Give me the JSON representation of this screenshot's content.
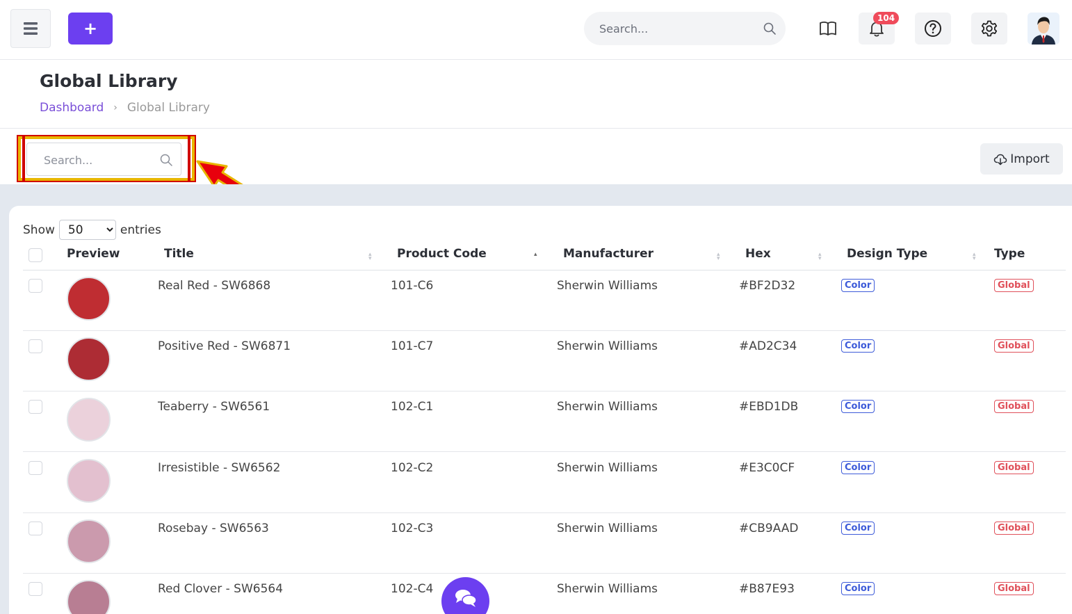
{
  "topbar": {
    "add_label": "+",
    "search_placeholder": "Search...",
    "notifications_count": "104"
  },
  "page": {
    "title": "Global Library",
    "breadcrumb": {
      "home": "Dashboard",
      "separator": "›",
      "current": "Global Library"
    }
  },
  "toolbar": {
    "search_placeholder": "Search...",
    "import_label": "Import"
  },
  "table": {
    "show_label": "Show",
    "entries_value": "50",
    "entries_label": "entries",
    "columns": {
      "preview": "Preview",
      "title": "Title",
      "product_code": "Product Code",
      "manufacturer": "Manufacturer",
      "hex": "Hex",
      "design_type": "Design Type",
      "type": "Type"
    },
    "rows": [
      {
        "title": "Real Red - SW6868",
        "code": "101-C6",
        "manufacturer": "Sherwin Williams",
        "hex": "#BF2D32",
        "design_type": "Color",
        "type": "Global",
        "swatch": "#BF2D32"
      },
      {
        "title": "Positive Red - SW6871",
        "code": "101-C7",
        "manufacturer": "Sherwin Williams",
        "hex": "#AD2C34",
        "design_type": "Color",
        "type": "Global",
        "swatch": "#AD2C34"
      },
      {
        "title": "Teaberry - SW6561",
        "code": "102-C1",
        "manufacturer": "Sherwin Williams",
        "hex": "#EBD1DB",
        "design_type": "Color",
        "type": "Global",
        "swatch": "#EBD1DB"
      },
      {
        "title": "Irresistible - SW6562",
        "code": "102-C2",
        "manufacturer": "Sherwin Williams",
        "hex": "#E3C0CF",
        "design_type": "Color",
        "type": "Global",
        "swatch": "#E3C0CF"
      },
      {
        "title": "Rosebay - SW6563",
        "code": "102-C3",
        "manufacturer": "Sherwin Williams",
        "hex": "#CB9AAD",
        "design_type": "Color",
        "type": "Global",
        "swatch": "#CB9AAD"
      },
      {
        "title": "Red Clover - SW6564",
        "code": "102-C4",
        "manufacturer": "Sherwin Williams",
        "hex": "#B87E93",
        "design_type": "Color",
        "type": "Global",
        "swatch": "#B87E93"
      }
    ]
  },
  "colors": {
    "primary": "#6C3FF0",
    "link": "#7A4FD8",
    "tag_color": "#3D5BD9",
    "tag_global": "#E0505A",
    "highlight_border": "#E8B500",
    "highlight_outline": "#D00000"
  }
}
